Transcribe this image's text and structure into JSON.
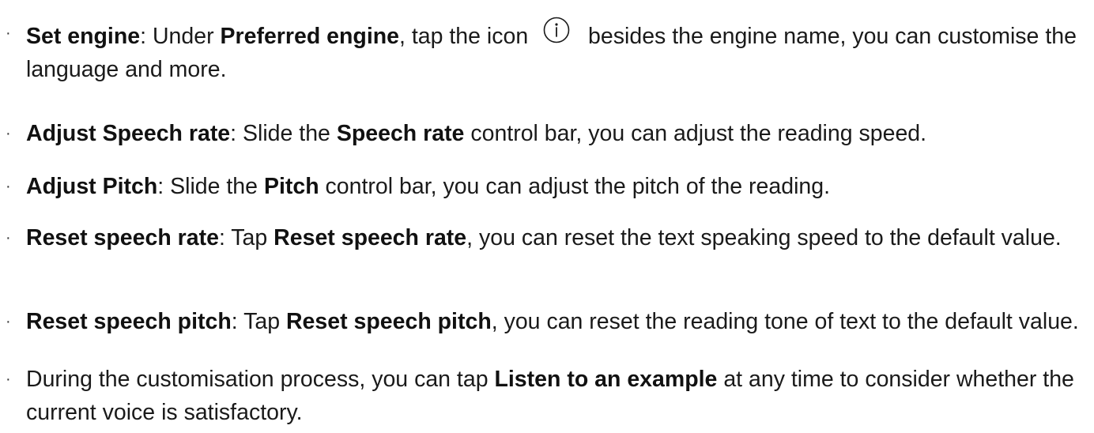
{
  "items": [
    {
      "term": "Set engine",
      "sep": ": Under ",
      "em1": "Preferred engine",
      "mid": ", tap the icon ",
      "icon": "info-circle-icon",
      "rest": " besides the engine name, you can customise the language and more."
    },
    {
      "term": "Adjust Speech rate",
      "sep": ": Slide the ",
      "em1": "Speech rate",
      "rest": " control bar, you can adjust the reading speed."
    },
    {
      "term": "Adjust Pitch",
      "sep": ": Slide the ",
      "em1": "Pitch",
      "rest": " control bar, you can adjust the pitch of the reading."
    },
    {
      "term": "Reset speech rate",
      "sep": ": Tap ",
      "em1": "Reset speech rate",
      "rest": ", you can reset the text speaking speed to the default value."
    },
    {
      "term": "Reset speech pitch",
      "sep": ": Tap ",
      "em1": "Reset speech pitch",
      "rest": ", you can reset the reading tone of text to the default value."
    },
    {
      "pre": "During the customisation process, you can tap ",
      "em1": "Listen to an example",
      "rest": " at any time to consider whether the current voice is satisfactory."
    }
  ],
  "bullet_char": "·"
}
